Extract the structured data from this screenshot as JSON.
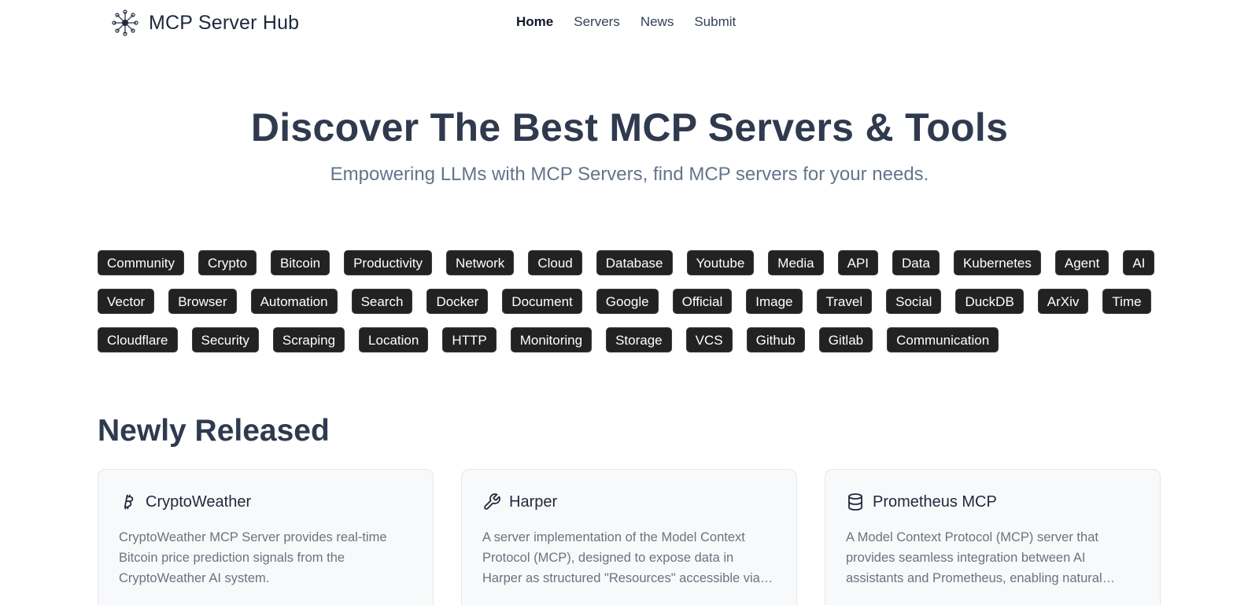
{
  "header": {
    "brand": "MCP Server Hub",
    "brand_icon": "network-hub-icon",
    "nav": [
      {
        "label": "Home",
        "active": true
      },
      {
        "label": "Servers",
        "active": false
      },
      {
        "label": "News",
        "active": false
      },
      {
        "label": "Submit",
        "active": false
      }
    ]
  },
  "hero": {
    "title": "Discover The Best MCP Servers & Tools",
    "subtitle": "Empowering LLMs with MCP Servers, find MCP servers for your needs."
  },
  "tags": [
    "Community",
    "Crypto",
    "Bitcoin",
    "Productivity",
    "Network",
    "Cloud",
    "Database",
    "Youtube",
    "Media",
    "API",
    "Data",
    "Kubernetes",
    "Agent",
    "AI",
    "Vector",
    "Browser",
    "Automation",
    "Search",
    "Docker",
    "Document",
    "Google",
    "Official",
    "Image",
    "Travel",
    "Social",
    "DuckDB",
    "ArXiv",
    "Time",
    "Cloudflare",
    "Security",
    "Scraping",
    "Location",
    "HTTP",
    "Monitoring",
    "Storage",
    "VCS",
    "Github",
    "Gitlab",
    "Communication"
  ],
  "newly_released": {
    "title": "Newly Released",
    "cards": [
      {
        "title": "CryptoWeather",
        "icon": "bitcoin-icon",
        "description": "CryptoWeather MCP Server provides real-time Bitcoin price prediction signals from the CryptoWeather AI system."
      },
      {
        "title": "Harper",
        "icon": "wrench-icon",
        "description": "A server implementation of the Model Context Protocol (MCP), designed to expose data in Harper as structured \"Resources\" accessible via standardized MCP interfaces."
      },
      {
        "title": "Prometheus MCP",
        "icon": "database-icon",
        "description": "A Model Context Protocol (MCP) server that provides seamless integration between AI assistants and Prometheus, enabling natural language interactions with your monitoring infrastructure."
      }
    ]
  },
  "colors": {
    "tag_bg": "#222222",
    "heading": "#2f3a4e",
    "muted": "#64748b",
    "card_bg": "#f8f9fa"
  }
}
